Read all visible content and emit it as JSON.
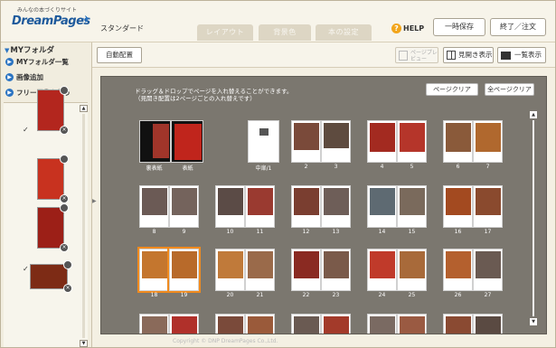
{
  "header": {
    "logo_tagline": "みんなの本づくりサイト",
    "logo_text": "DreamPages",
    "mode": "スタンダード",
    "tabs": [
      "レイアウト",
      "背景色",
      "本の設定"
    ],
    "help": "HELP",
    "buttons": {
      "save": "一時保存",
      "finish": "終了／注文"
    }
  },
  "sidebar": {
    "title": "MYフォルダ",
    "links": [
      "MYフォルダ一覧",
      "画像追加",
      "フリー画像を使う"
    ]
  },
  "toolbar": {
    "auto_layout": "自動配置",
    "preview": "ページプレビュー",
    "spread_view": "見開き表示",
    "grid_view": "一覧表示"
  },
  "panel": {
    "instruction_line1": "ドラッグ＆ドロップでページを入れ替えることができます。",
    "instruction_line2": "（見開き配置は2ページごとの入れ替えです）",
    "page_clear": "ページクリア",
    "all_clear": "全ページクリア",
    "labels": {
      "back_cover": "裏表紙",
      "front_cover": "表紙",
      "title_page": "中扉/1",
      "p2": "2",
      "p3": "3",
      "p4": "4",
      "p5": "5",
      "p6": "6",
      "p7": "7",
      "p8": "8",
      "p9": "9",
      "p10": "10",
      "p11": "11",
      "p12": "12",
      "p13": "13",
      "p14": "14",
      "p15": "15",
      "p16": "16",
      "p17": "17",
      "p18": "18",
      "p19": "19",
      "p20": "20",
      "p21": "21",
      "p22": "22",
      "p23": "23",
      "p24": "24",
      "p25": "25",
      "p26": "26",
      "p27": "27"
    }
  },
  "footer": "Copyright © DNP DreamPages Co.,Ltd.",
  "colors": {
    "panel_bg": "#7b776f",
    "accent_blue": "#2b74c2",
    "selected_orange": "#f08a1e"
  }
}
